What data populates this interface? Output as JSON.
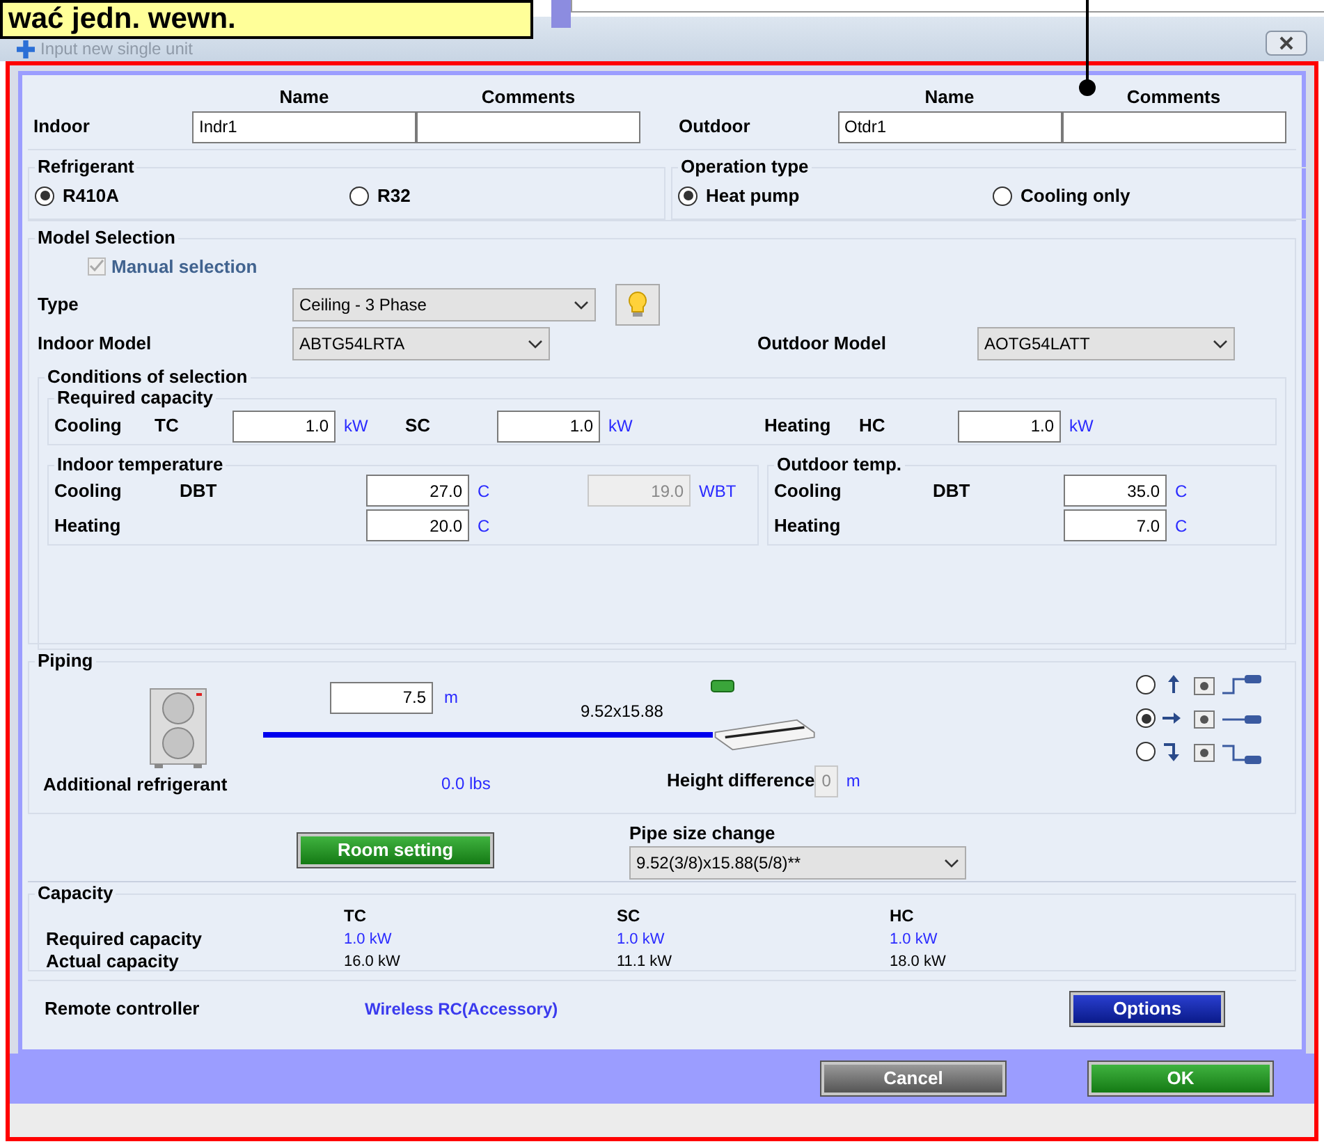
{
  "callout": {
    "text": "wać jedn. wewn."
  },
  "window": {
    "title": "Input new single unit"
  },
  "units": [
    {
      "label": "Indoor",
      "name_header": "Name",
      "comments_header": "Comments",
      "name": "Indr1"
    },
    {
      "label": "Outdoor",
      "name_header": "Name",
      "comments_header": "Comments",
      "name": "Otdr1"
    }
  ],
  "refrigerant": {
    "title": "Refrigerant",
    "options": [
      {
        "label": "R410A",
        "selected": true
      },
      {
        "label": "R32",
        "selected": false
      }
    ]
  },
  "operation_type": {
    "title": "Operation type",
    "options": [
      {
        "label": "Heat pump",
        "selected": true
      },
      {
        "label": "Cooling only",
        "selected": false
      }
    ]
  },
  "model_selection": {
    "title": "Model Selection",
    "manual_selection": {
      "label": "Manual selection",
      "checked": true,
      "disabled": true
    },
    "type": {
      "label": "Type",
      "value": "Ceiling - 3 Phase"
    },
    "indoor_model": {
      "label": "Indoor Model",
      "value": "ABTG54LRTA"
    },
    "outdoor_model": {
      "label": "Outdoor Model",
      "value": "AOTG54LATT"
    }
  },
  "conditions": {
    "title": "Conditions of selection",
    "required_capacity": {
      "title": "Required capacity",
      "cooling_label": "Cooling",
      "heating_label": "Heating",
      "fields": [
        {
          "label": "TC",
          "value": "1.0",
          "unit": "kW"
        },
        {
          "label": "SC",
          "value": "1.0",
          "unit": "kW"
        },
        {
          "label": "HC",
          "value": "1.0",
          "unit": "kW"
        }
      ]
    },
    "indoor_temperature": {
      "title": "Indoor temperature",
      "cooling": {
        "label": "Cooling",
        "sub": "DBT",
        "value": "27.0",
        "unit": "C"
      },
      "wbt": {
        "value": "19.0",
        "unit": "WBT",
        "disabled": true
      },
      "heating": {
        "label": "Heating",
        "value": "20.0",
        "unit": "C"
      }
    },
    "outdoor_temp": {
      "title": "Outdoor temp.",
      "cooling": {
        "label": "Cooling",
        "sub": "DBT",
        "value": "35.0",
        "unit": "C"
      },
      "heating": {
        "label": "Heating",
        "value": "7.0",
        "unit": "C"
      }
    }
  },
  "piping": {
    "title": "Piping",
    "length": {
      "value": "7.5",
      "unit": "m"
    },
    "pipe_size": "9.52x15.88",
    "additional_refrigerant": {
      "label": "Additional refrigerant",
      "value": "0.0 lbs"
    },
    "height_difference": {
      "label": "Height difference",
      "value": "0",
      "unit": "m",
      "disabled": true
    },
    "layouts": [
      {
        "kind": "up",
        "selected": false
      },
      {
        "kind": "level",
        "selected": true
      },
      {
        "kind": "down",
        "selected": false
      }
    ],
    "room_setting": "Room setting",
    "pipe_size_change": {
      "label": "Pipe size change",
      "value": "9.52(3/8)x15.88(5/8)**"
    }
  },
  "capacity": {
    "title": "Capacity",
    "columns": [
      "TC",
      "SC",
      "HC"
    ],
    "rows": [
      {
        "label": "Required capacity",
        "highlight": true,
        "values": [
          "1.0 kW",
          "1.0 kW",
          "1.0 kW"
        ]
      },
      {
        "label": "Actual capacity",
        "highlight": false,
        "values": [
          "16.0 kW",
          "11.1 kW",
          "18.0 kW"
        ]
      }
    ]
  },
  "remote_controller": {
    "label": "Remote controller",
    "value": "Wireless RC(Accessory)",
    "button": "Options"
  },
  "buttons": [
    {
      "label": "Cancel",
      "kind": "cancel"
    },
    {
      "label": "OK",
      "kind": "ok"
    }
  ]
}
